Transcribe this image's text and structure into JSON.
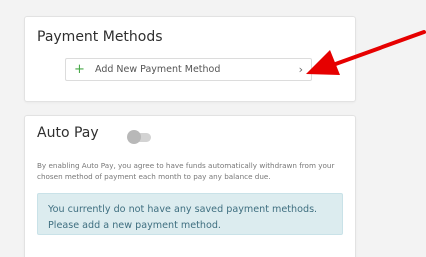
{
  "payment_methods": {
    "title": "Payment Methods",
    "add_button": {
      "plus": "+",
      "label": "Add New Payment Method",
      "chevron": "›"
    }
  },
  "auto_pay": {
    "title": "Auto Pay",
    "toggle_on": false,
    "description": "By enabling Auto Pay, you agree to have funds automatically withdrawn from your chosen method of payment each month to pay any balance due.",
    "notice": "You currently do not have any saved payment methods. Please add a new payment method."
  },
  "icons": {
    "plus": "plus-icon",
    "chevron": "chevron-right-icon",
    "annotation": "red-arrow-icon"
  },
  "colors": {
    "accent_green": "#48a948",
    "notice_bg": "#dcecef",
    "notice_text": "#3f6f80",
    "annotation_red": "#e60000"
  }
}
